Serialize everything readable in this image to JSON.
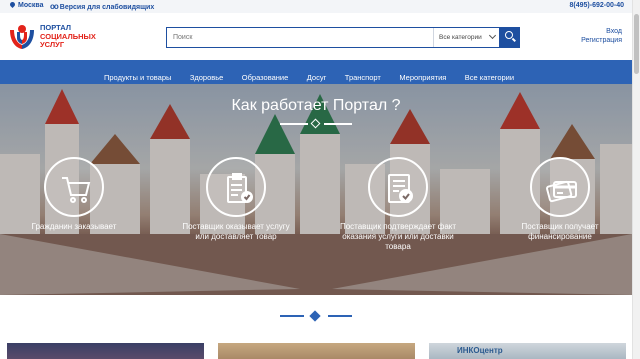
{
  "topbar": {
    "city": "Москва",
    "accessibility": "Версия для слабовидящих",
    "phone": "8(495)-692-00-40"
  },
  "logo": {
    "line1": "Портал",
    "line2": "социальных",
    "line3": "услуг",
    "colors": {
      "red": "#e2231a",
      "blue": "#1e4fa0"
    }
  },
  "search": {
    "placeholder": "Поиск",
    "category": "Все категории"
  },
  "auth": {
    "login": "Вход",
    "register": "Регистрация"
  },
  "nav": {
    "items": [
      {
        "label": "Продукты и товары"
      },
      {
        "label": "Здоровье"
      },
      {
        "label": "Образование"
      },
      {
        "label": "Досуг"
      },
      {
        "label": "Транспорт"
      },
      {
        "label": "Мероприятия"
      },
      {
        "label": "Все категории"
      }
    ]
  },
  "hero": {
    "title": "Как работает Портал ?",
    "steps": [
      {
        "icon": "shopping-cart-icon",
        "caption": "Гражданин заказывает"
      },
      {
        "icon": "clipboard-checklist-icon",
        "caption": "Поставщик оказывает услугу или доставляет товар"
      },
      {
        "icon": "document-check-icon",
        "caption": "Поставщик подтверждает факт оказания услуги или доставки товара"
      },
      {
        "icon": "credit-cards-icon",
        "caption": "Поставщик получает финансирование"
      }
    ]
  },
  "cards": {
    "third_label": "ИНКОцентр"
  },
  "colors": {
    "brand_blue": "#1e4fa0",
    "nav_blue": "#2d63b5",
    "brand_red": "#e2231a"
  }
}
